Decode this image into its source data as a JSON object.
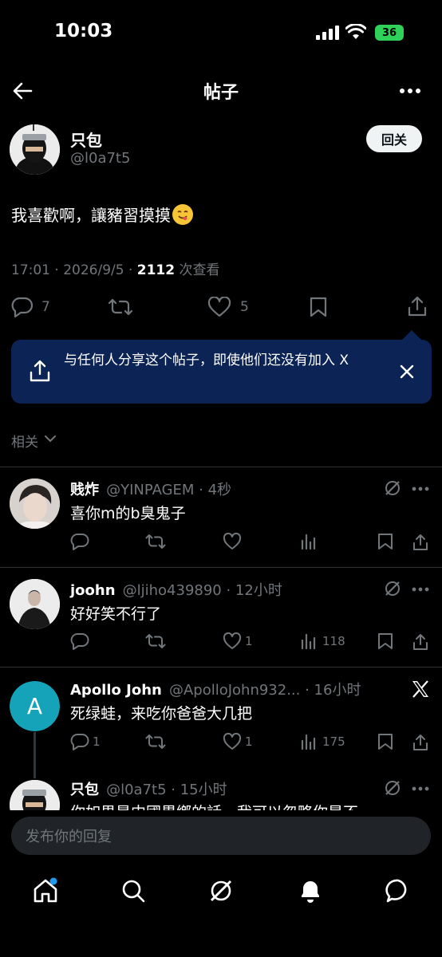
{
  "status_bar": {
    "time": "10:03",
    "battery": "36"
  },
  "header": {
    "title": "帖子"
  },
  "post": {
    "author_name": "只包",
    "author_handle": "@l0a7t5",
    "follow_label": "回关",
    "text": "我喜歡啊，讓豬習摸摸",
    "time": "17:01 · 2026/9/5 · ",
    "views": "2112",
    "views_label": " 次查看",
    "replies": "7",
    "likes": "5"
  },
  "share_banner": {
    "text": "与任何人分享这个帖子，即使他们还没有加入 X"
  },
  "related_label": "相关",
  "replies": [
    {
      "name": "贱炸",
      "meta": "@YINPAGEM · 4秒",
      "text": "喜你m的b臭鬼子",
      "replies": "",
      "retweets": "",
      "likes": "",
      "views": ""
    },
    {
      "name": "joohn",
      "meta": "@ljiho439890 · 12小时",
      "text": "好好笑不行了",
      "replies": "",
      "retweets": "",
      "likes": "1",
      "views": "118"
    },
    {
      "name": "Apollo John",
      "meta": "@ApolloJohn932... · 16小时",
      "text": "死绿蛙，来吃你爸爸大几把",
      "avatar_letter": "A",
      "replies": "1",
      "retweets": "",
      "likes": "1",
      "views": "175"
    },
    {
      "name": "只包",
      "meta": "@l0a7t5 · 15小时",
      "text": "你如果是中國異鄉的話，我可以忽略你是不"
    }
  ],
  "compose": {
    "placeholder": "发布你的回复"
  },
  "colors": {
    "accent": "#1d9bf0",
    "banner": "#0c2356",
    "avatar_a": "#14a3b8"
  }
}
